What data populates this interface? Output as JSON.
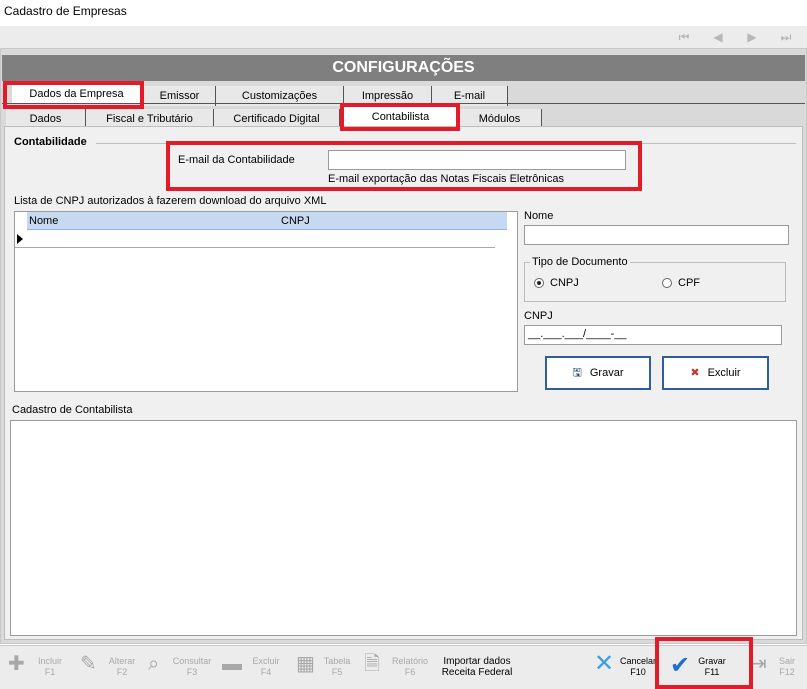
{
  "window": {
    "title": "Cadastro de Empresas"
  },
  "nav": {
    "first": "⏮",
    "prev": "◀",
    "next": "▶",
    "last": "⏭"
  },
  "header": {
    "title": "CONFIGURAÇÕES"
  },
  "tabs_top": [
    "Dados da Empresa",
    "Emissor",
    "Customizações",
    "Impressão",
    "E-mail"
  ],
  "tabs_sub": [
    "Dados",
    "Fiscal e Tributário",
    "Certificado Digital",
    "Contabilista",
    "Módulos"
  ],
  "contabilidade": {
    "section_label": "Contabilidade",
    "email_label": "E-mail da Contabilidade",
    "email_value": "",
    "email_hint": "E-mail exportação das Notas Fiscais Eletrônicas"
  },
  "cnpj_list": {
    "title": "Lista de CNPJ autorizados à fazerem download do arquivo XML",
    "columns": [
      "Nome",
      "CNPJ"
    ]
  },
  "form": {
    "nome_label": "Nome",
    "nome_value": "",
    "tipo_label": "Tipo de Documento",
    "opt_cnpj": "CNPJ",
    "opt_cpf": "CPF",
    "cnpj_label": "CNPJ",
    "cnpj_value": "__.___.___/____-__",
    "gravar_label": "Gravar",
    "excluir_label": "Excluir"
  },
  "cadastro": {
    "title": "Cadastro de Contabilista"
  },
  "toolbar": {
    "incluir": [
      "Incluir",
      "F1"
    ],
    "alterar": [
      "Alterar",
      "F2"
    ],
    "consultar": [
      "Consultar",
      "F3"
    ],
    "excluir": [
      "Excluir",
      "F4"
    ],
    "tabela": [
      "Tabela",
      "F5"
    ],
    "relatorio": [
      "Relatório",
      "F6"
    ],
    "importar": [
      "Importar dados",
      "Receita Federal"
    ],
    "cancelar": [
      "Cancelar",
      "F10"
    ],
    "gravar": [
      "Gravar",
      "F11"
    ],
    "sair": [
      "Sair",
      "F12"
    ]
  },
  "colors": {
    "highlight": "#e11b2a",
    "header_bg": "#7f7f7f",
    "grid_header": "#c5d9f1",
    "confirm": "#1e6fd9",
    "cancel": "#3aa0e0"
  }
}
